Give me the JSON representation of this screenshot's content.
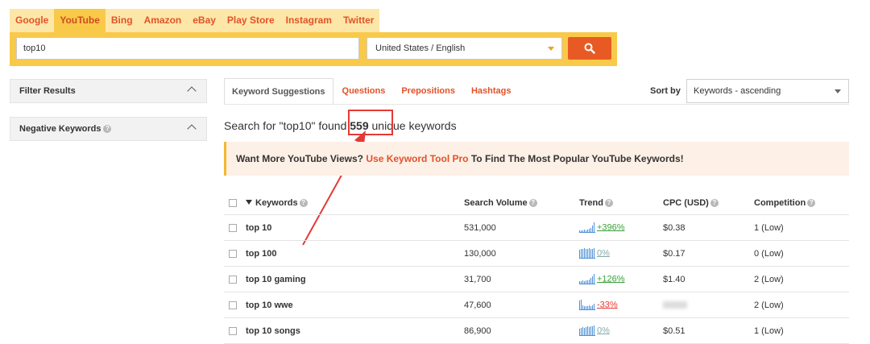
{
  "engines": [
    "Google",
    "YouTube",
    "Bing",
    "Amazon",
    "eBay",
    "Play Store",
    "Instagram",
    "Twitter"
  ],
  "search": {
    "value": "top10",
    "language": "United States / English"
  },
  "filters": [
    {
      "label": "Filter Results",
      "help": false
    },
    {
      "label": "Negative Keywords",
      "help": true
    }
  ],
  "result_tabs": [
    "Keyword Suggestions",
    "Questions",
    "Prepositions",
    "Hashtags"
  ],
  "sort": {
    "label": "Sort by",
    "value": "Keywords - ascending"
  },
  "found": {
    "prefix": "Search for \"top10\" found ",
    "count": "559",
    "suffix": " unique keywords"
  },
  "promo": {
    "text_before": "Want More YouTube Views? ",
    "link": "Use Keyword Tool Pro",
    "text_after": " To Find The Most Popular YouTube Keywords!"
  },
  "table": {
    "headers": {
      "keywords": "Keywords",
      "volume": "Search Volume",
      "trend": "Trend",
      "cpc": "CPC (USD)",
      "competition": "Competition"
    },
    "rows": [
      {
        "keyword": "top 10",
        "volume": "531,000",
        "trend": "+396%",
        "trend_dir": "up",
        "spark": [
          1,
          1,
          1,
          2,
          1,
          2,
          3,
          4,
          6,
          10
        ],
        "cpc": "$0.38",
        "competition": "1 (Low)"
      },
      {
        "keyword": "top 100",
        "volume": "130,000",
        "trend": "0%",
        "trend_dir": "zero",
        "spark": [
          8,
          9,
          9,
          10,
          9,
          9,
          10,
          9,
          9,
          10
        ],
        "cpc": "$0.17",
        "competition": "0 (Low)"
      },
      {
        "keyword": "top 10 gaming",
        "volume": "31,700",
        "trend": "+126%",
        "trend_dir": "up",
        "spark": [
          2,
          2,
          3,
          2,
          3,
          3,
          4,
          5,
          7,
          10
        ],
        "cpc": "$1.40",
        "competition": "2 (Low)"
      },
      {
        "keyword": "top 10 wwe",
        "volume": "47,600",
        "trend": "-33%",
        "trend_dir": "down",
        "spark": [
          9,
          10,
          4,
          3,
          3,
          3,
          4,
          3,
          4,
          5
        ],
        "cpc": "",
        "competition": "2 (Low)"
      },
      {
        "keyword": "top 10 songs",
        "volume": "86,900",
        "trend": "0%",
        "trend_dir": "zero",
        "spark": [
          6,
          7,
          8,
          7,
          8,
          9,
          8,
          9,
          9,
          10
        ],
        "cpc": "$0.51",
        "competition": "1 (Low)"
      }
    ]
  }
}
